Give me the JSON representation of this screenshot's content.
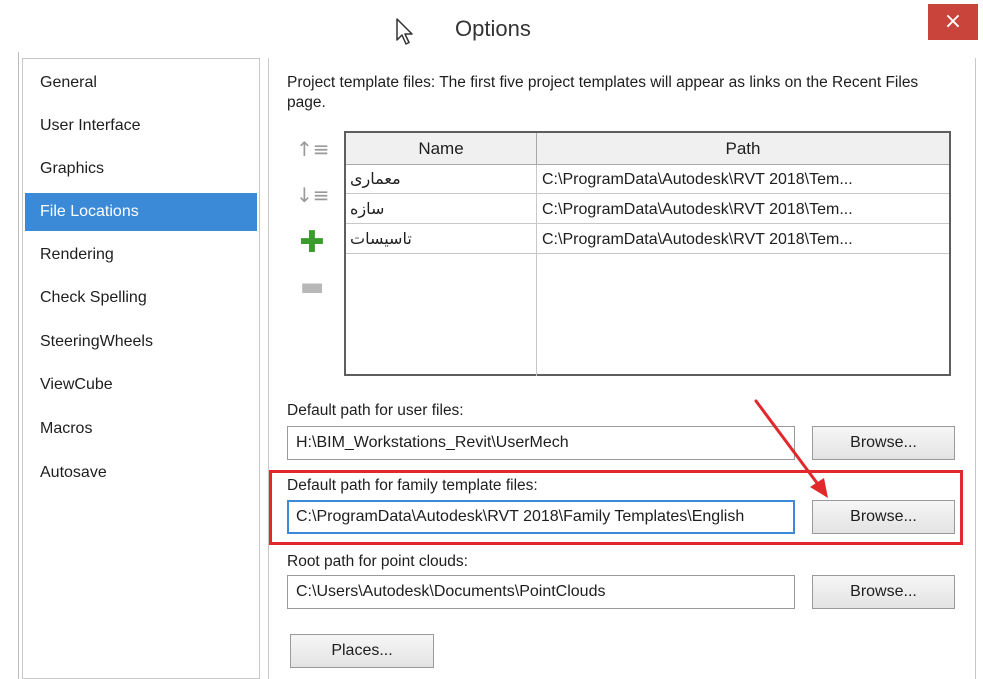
{
  "window": {
    "title": "Options",
    "close_glyph": "×"
  },
  "sidebar": {
    "items": [
      {
        "label": "General"
      },
      {
        "label": "User Interface"
      },
      {
        "label": "Graphics"
      },
      {
        "label": "File Locations",
        "active": true
      },
      {
        "label": "Rendering"
      },
      {
        "label": "Check Spelling"
      },
      {
        "label": "SteeringWheels"
      },
      {
        "label": "ViewCube"
      },
      {
        "label": "Macros"
      },
      {
        "label": "Autosave"
      }
    ]
  },
  "project_templates": {
    "description": "Project template files:  The first five project templates will appear as links on the Recent Files page.",
    "tools": [
      {
        "icon": "move-up-icon",
        "glyph": "↑≡"
      },
      {
        "icon": "move-down-icon",
        "glyph": "↓≡"
      },
      {
        "icon": "add-icon",
        "glyph": "✚"
      },
      {
        "icon": "remove-icon",
        "glyph": "▬"
      }
    ],
    "columns": [
      "Name",
      "Path"
    ],
    "rows": [
      {
        "name": "معماری",
        "path": "C:\\ProgramData\\Autodesk\\RVT 2018\\Tem..."
      },
      {
        "name": "سازه",
        "path": "C:\\ProgramData\\Autodesk\\RVT 2018\\Tem..."
      },
      {
        "name": "تاسیسات",
        "path": "C:\\ProgramData\\Autodesk\\RVT 2018\\Tem..."
      }
    ]
  },
  "user_files": {
    "label": "Default path for user files:",
    "value": "H:\\BIM_Workstations_Revit\\UserMech",
    "browse_label": "Browse..."
  },
  "family_templates": {
    "label": "Default path for family template files:",
    "value": "C:\\ProgramData\\Autodesk\\RVT 2018\\Family Templates\\English",
    "browse_label": "Browse..."
  },
  "point_clouds": {
    "label": "Root path for point clouds:",
    "value": "C:\\Users\\Autodesk\\Documents\\PointClouds",
    "browse_label": "Browse..."
  },
  "places_label": "Places...",
  "colors": {
    "accent": "#3b8ad8",
    "highlight": "#e0282d",
    "close": "#c9443a",
    "add_icon": "#3b9b2f"
  }
}
